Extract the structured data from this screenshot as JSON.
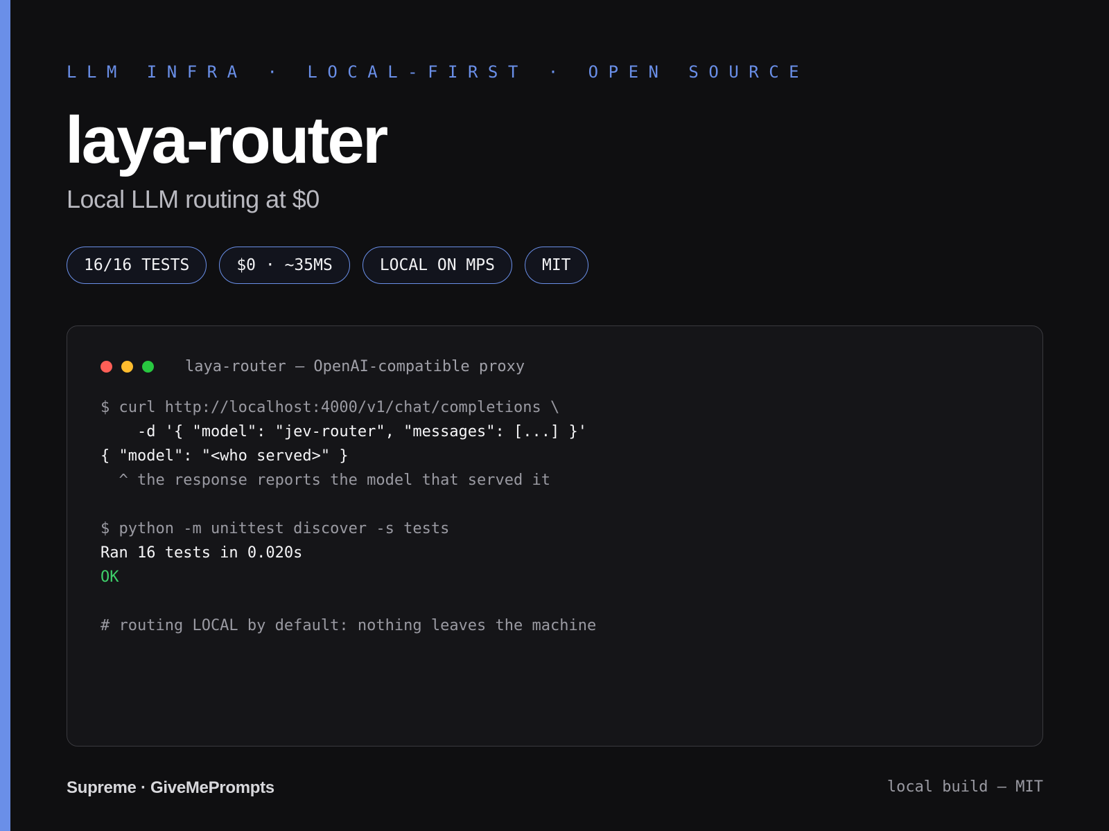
{
  "eyebrow": "LLM INFRA · LOCAL-FIRST · OPEN SOURCE",
  "title": "laya-router",
  "subtitle": "Local LLM routing at $0",
  "badges": [
    "16/16 TESTS",
    "$0 · ~35MS",
    "LOCAL ON MPS",
    "MIT"
  ],
  "terminal": {
    "title": "laya-router — OpenAI-compatible proxy",
    "lines": [
      "$ curl http://localhost:4000/v1/chat/completions \\",
      "    -d '{ \"model\": \"jev-router\", \"messages\": [...] }'",
      "{ \"model\": \"<who served>\" }",
      "  ^ the response reports the model that served it",
      "",
      "$ python -m unittest discover -s tests",
      "Ran 16 tests in 0.020s",
      "OK",
      "",
      "# routing LOCAL by default: nothing leaves the machine"
    ]
  },
  "footer": {
    "left": "Supreme · GiveMePrompts",
    "right": "local build — MIT"
  },
  "colors": {
    "accent": "#6a8fe8",
    "background": "#0f0f11",
    "ok": "#3ecf6a"
  }
}
